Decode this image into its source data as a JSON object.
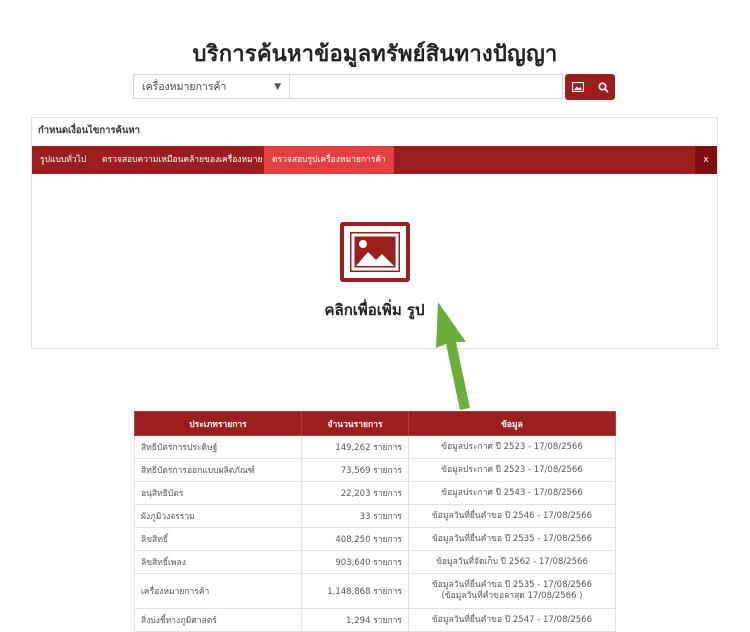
{
  "page": {
    "title": "บริการค้นหาข้อมูลทรัพย์สินทางปัญญา"
  },
  "search": {
    "type_selected": "เครื่องหมายการค้า",
    "query_value": "",
    "image_button_icon": "image-icon",
    "search_button_icon": "search-icon"
  },
  "panel": {
    "header": "กำหนดเงื่อนไขการค้นหา",
    "tabs": [
      {
        "label": "รูปแบบทั่วไป",
        "active": false
      },
      {
        "label": "ตรวจสอบความเหมือนคล้ายของเครื่องหมาย",
        "active": false
      },
      {
        "label": "ตรวจสอบรูปเครื่องหมายการค้า",
        "active": true
      }
    ],
    "close_label": "x",
    "upload_label": "คลิกเพื่อเพิ่ม รูป",
    "upload_icon": "image-upload-icon"
  },
  "colors": {
    "brand": "#9c1f1f",
    "tab_active": "#e14040",
    "arrow": "#6cae3e"
  },
  "table": {
    "headers": [
      "ประเภทรายการ",
      "จำนวนรายการ",
      "ข้อมูล"
    ],
    "rows": [
      {
        "type": "สิทธิบัตรการประดิษฐ์",
        "count": "149,262 รายการ",
        "info": "ข้อมูลประกาศ ปี 2523 - 17/08/2566",
        "info2": ""
      },
      {
        "type": "สิทธิบัตรการออกแบบผลิตภัณฑ์",
        "count": "73,569 รายการ",
        "info": "ข้อมูลประกาศ ปี 2523 - 17/08/2566",
        "info2": ""
      },
      {
        "type": "อนุสิทธิบัตร",
        "count": "22,203 รายการ",
        "info": "ข้อมูลประกาศ ปี 2543 - 17/08/2566",
        "info2": ""
      },
      {
        "type": "ผังภูมิวงจรรวม",
        "count": "33 รายการ",
        "info": "ข้อมูลวันที่ยื่นคำขอ ปี 2546 - 17/08/2566",
        "info2": ""
      },
      {
        "type": "ลิขสิทธิ์",
        "count": "408,250 รายการ",
        "info": "ข้อมูลวันที่ยื่นคำขอ ปี 2535 - 17/08/2566",
        "info2": ""
      },
      {
        "type": "ลิขสิทธิ์เพลง",
        "count": "903,640 รายการ",
        "info": "ข้อมูลวันที่จัดเก็บ ปี 2562 - 17/08/2566",
        "info2": ""
      },
      {
        "type": "เครื่องหมายการค้า",
        "count": "1,148,868 รายการ",
        "info": "ข้อมูลวันที่ยื่นคำขอ ปี 2535 - 17/08/2566",
        "info2": "(ข้อมูลวันที่คำขอล่าสุด 17/08/2566 )"
      },
      {
        "type": "สิ่งบ่งชี้ทางภูมิศาสตร์",
        "count": "1,294 รายการ",
        "info": "ข้อมูลวันที่ยื่นคำขอ ปี 2547 - 17/08/2566",
        "info2": ""
      }
    ]
  }
}
